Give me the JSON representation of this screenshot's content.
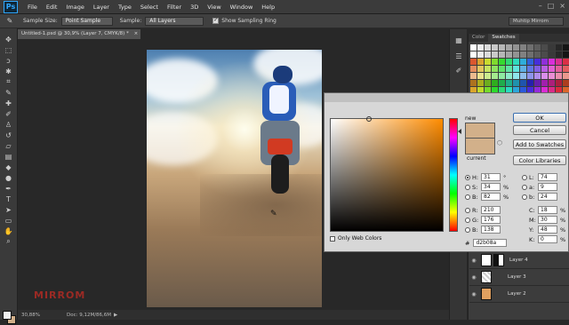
{
  "app": {
    "logo": "Ps"
  },
  "menu": [
    "File",
    "Edit",
    "Image",
    "Layer",
    "Type",
    "Select",
    "Filter",
    "3D",
    "View",
    "Window",
    "Help"
  ],
  "options_bar": {
    "sample_size_label": "Sample Size:",
    "sample_size_value": "Point Sample",
    "sample_label": "Sample:",
    "sample_value": "All Layers",
    "show_ring_label": "Show Sampling Ring",
    "workspace": "Muhtip Mirrom"
  },
  "document_tab": {
    "title": "Untitled-1.psd @ 30,9% (Layer 7, CMYK/8) *",
    "close": "×"
  },
  "status_bar": {
    "zoom": "30,88%",
    "doc": "Doc: 9,12M/86,6M"
  },
  "watermark": "MIRROM",
  "panels": {
    "tabs": [
      "Color",
      "Swatches"
    ],
    "active_tab": "Swatches"
  },
  "layers": [
    {
      "name": "Layer 4",
      "has_mask": true
    },
    {
      "name": "Layer 3",
      "has_mask": false
    },
    {
      "name": "Layer 2",
      "has_mask": false
    }
  ],
  "color_picker": {
    "new_label": "new",
    "current_label": "current",
    "buttons": {
      "ok": "OK",
      "cancel": "Cancel",
      "add": "Add to Swatches",
      "libraries": "Color Libraries"
    },
    "only_web_colors": "Only Web Colors",
    "hsb": [
      {
        "label": "H:",
        "value": "31",
        "unit": "°",
        "selected": true
      },
      {
        "label": "S:",
        "value": "34",
        "unit": "%",
        "selected": false
      },
      {
        "label": "B:",
        "value": "82",
        "unit": "%",
        "selected": false
      }
    ],
    "rgb": [
      {
        "label": "R:",
        "value": "210"
      },
      {
        "label": "G:",
        "value": "176"
      },
      {
        "label": "B:",
        "value": "138"
      }
    ],
    "lab": [
      {
        "label": "L:",
        "value": "74"
      },
      {
        "label": "a:",
        "value": "9"
      },
      {
        "label": "b:",
        "value": "24"
      }
    ],
    "cmyk": [
      {
        "label": "C:",
        "value": "18",
        "unit": "%"
      },
      {
        "label": "M:",
        "value": "30",
        "unit": "%"
      },
      {
        "label": "Y:",
        "value": "48",
        "unit": "%"
      },
      {
        "label": "K:",
        "value": "0",
        "unit": "%"
      }
    ],
    "hex_label": "#",
    "hex": "d2b08a",
    "color": "#d2b08a"
  }
}
